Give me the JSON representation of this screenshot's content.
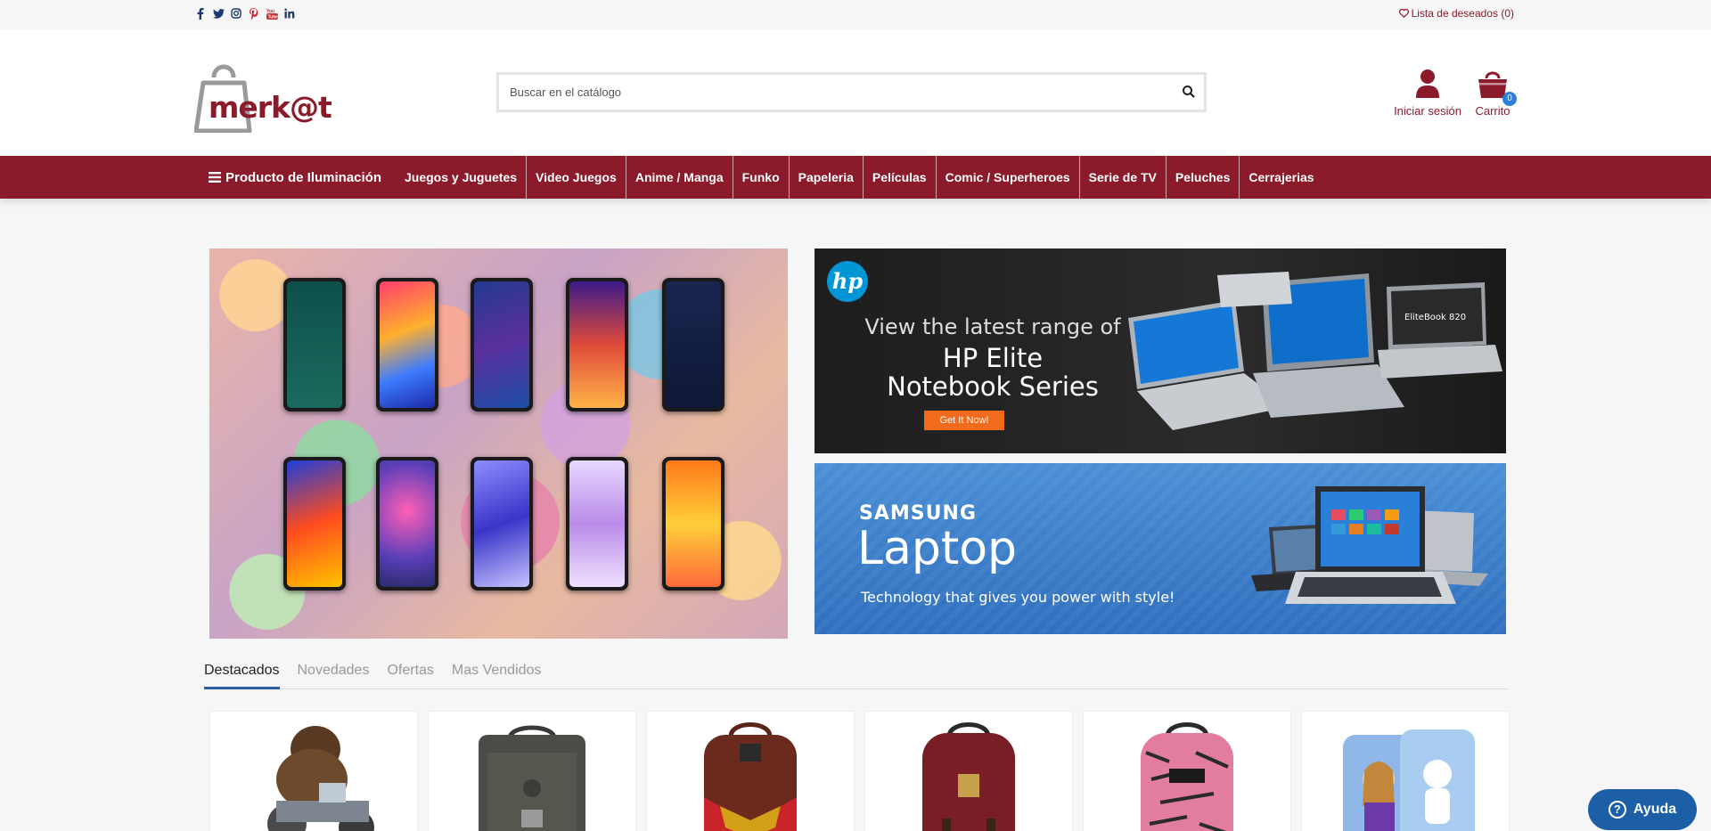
{
  "topbar": {
    "social_icons": [
      "facebook-icon",
      "twitter-icon",
      "instagram-icon",
      "pinterest-icon",
      "youtube-icon",
      "linkedin-icon"
    ],
    "wishlist_label": "Lista de deseados (0)"
  },
  "header": {
    "logo_text": "merk@t",
    "search_placeholder": "Buscar en el catálogo",
    "account_label": "Iniciar sesión",
    "cart_label": "Carrito",
    "cart_count": "0"
  },
  "nav": {
    "category_label": "Producto de Iluminación",
    "items": [
      "Juegos y Juguetes",
      "Video Juegos",
      "Anime / Manga",
      "Funko",
      "Papeleria",
      "Películas",
      "Comic / Superheroes",
      "Serie de TV",
      "Peluches",
      "Cerrajerias"
    ]
  },
  "banners": {
    "hp": {
      "logo": "hp",
      "line1": "View the latest range of",
      "line2": "HP Elite",
      "line3": "Notebook Series",
      "cta": "Get It Now!",
      "device_label": "EliteBook 820"
    },
    "samsung": {
      "brand": "SAMSUNG",
      "title": "Laptop",
      "tagline": "Technology that gives you power with style!"
    }
  },
  "tabs": [
    "Destacados",
    "Novedades",
    "Ofertas",
    "Mas Vendidos"
  ],
  "active_tab": "Destacados",
  "help": {
    "label": "Ayuda"
  },
  "colors": {
    "brand": "#8b1a2b",
    "accent": "#2a5fa8",
    "badge": "#2a7fd8"
  }
}
